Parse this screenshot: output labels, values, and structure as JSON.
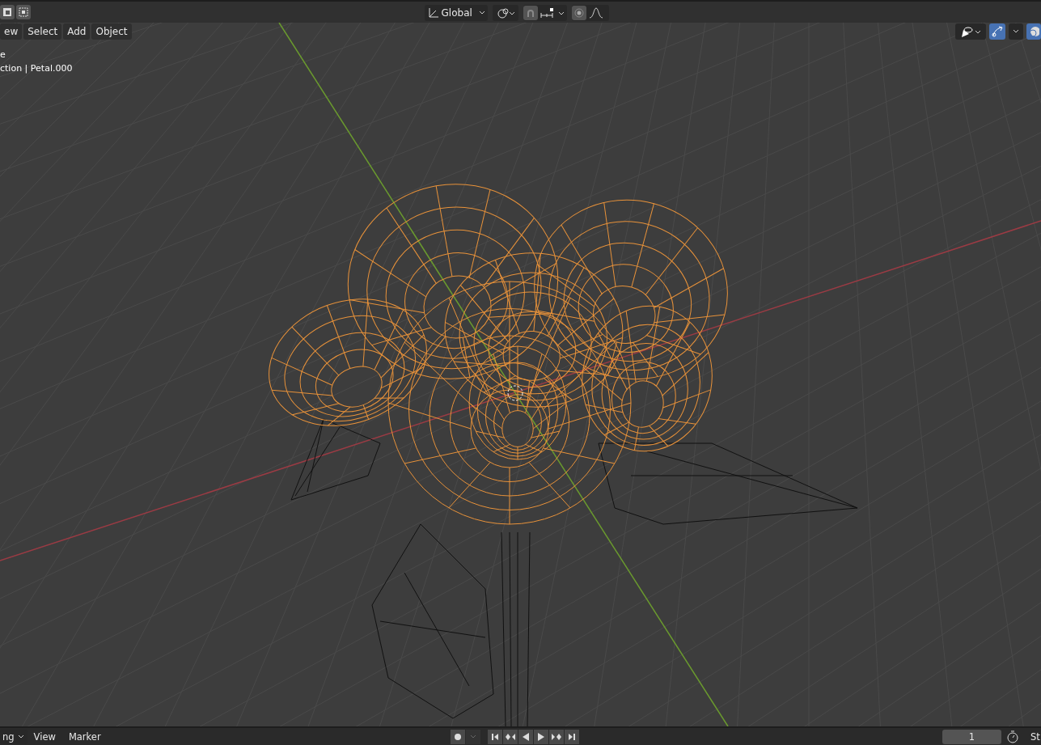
{
  "top_header": {
    "transform_orientation": "Global"
  },
  "viewport": {
    "menus": [
      {
        "label": "ew"
      },
      {
        "label": "Select"
      },
      {
        "label": "Add"
      },
      {
        "label": "Object"
      }
    ],
    "info": [
      "e",
      "ction | Petal.000"
    ]
  },
  "timeline": {
    "mode_dropdown": "ng",
    "menus": [
      "View",
      "Marker"
    ],
    "current_frame": "1",
    "cut_label": "St"
  }
}
